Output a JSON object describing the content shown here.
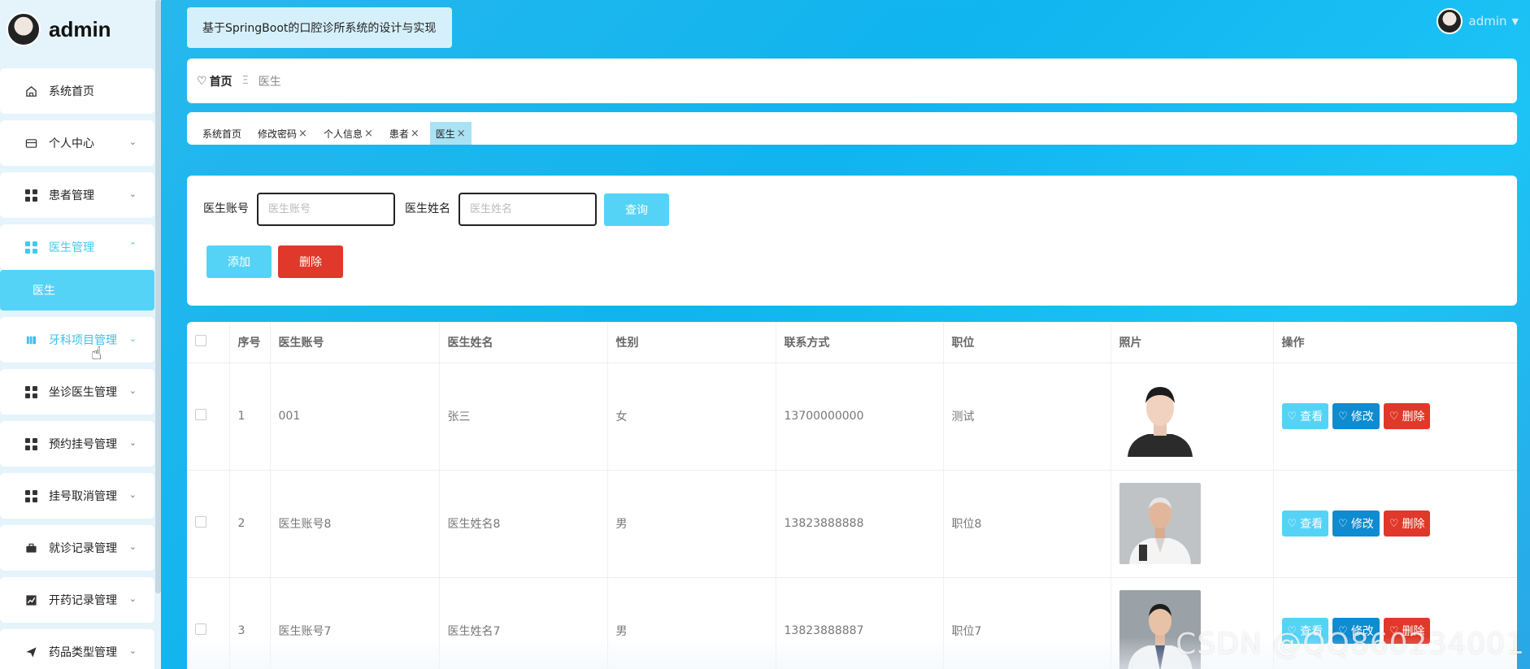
{
  "app": {
    "username": "admin",
    "system_title": "基于SpringBoot的口腔诊所系统的设计与实现"
  },
  "sidebar": {
    "items": [
      {
        "label": "系统首页",
        "icon": "home-icon",
        "has_arrow": false
      },
      {
        "label": "个人中心",
        "icon": "card-icon",
        "has_arrow": true,
        "arrow": "⌄"
      },
      {
        "label": "患者管理",
        "icon": "grid-icon",
        "has_arrow": true,
        "arrow": "⌄"
      },
      {
        "label": "医生管理",
        "icon": "grid-icon",
        "has_arrow": true,
        "arrow": "⌃",
        "active": true
      },
      {
        "label": "牙科项目管理",
        "icon": "book-icon",
        "has_arrow": true,
        "arrow": "⌄"
      },
      {
        "label": "坐诊医生管理",
        "icon": "grid-icon",
        "has_arrow": true,
        "arrow": "⌄"
      },
      {
        "label": "预约挂号管理",
        "icon": "grid-icon",
        "has_arrow": true,
        "arrow": "⌄"
      },
      {
        "label": "挂号取消管理",
        "icon": "grid-icon",
        "has_arrow": true,
        "arrow": "⌄"
      },
      {
        "label": "就诊记录管理",
        "icon": "briefcase-icon",
        "has_arrow": true,
        "arrow": "⌄"
      },
      {
        "label": "开药记录管理",
        "icon": "chart-icon",
        "has_arrow": true,
        "arrow": "⌄"
      },
      {
        "label": "药品类型管理",
        "icon": "send-icon",
        "has_arrow": true,
        "arrow": "⌄"
      }
    ],
    "submenu_active": "医生"
  },
  "breadcrumb": {
    "home": "首页",
    "separator": "Ξ",
    "current": "医生"
  },
  "tags": [
    {
      "label": "系统首页",
      "closable": false
    },
    {
      "label": "修改密码",
      "closable": true
    },
    {
      "label": "个人信息",
      "closable": true
    },
    {
      "label": "患者",
      "closable": true
    },
    {
      "label": "医生",
      "closable": true,
      "active": true
    }
  ],
  "search": {
    "account_label": "医生账号",
    "account_placeholder": "医生账号",
    "name_label": "医生姓名",
    "name_placeholder": "医生姓名",
    "query_button": "查询",
    "add_button": "添加",
    "delete_button": "删除"
  },
  "table": {
    "headers": [
      "序号",
      "医生账号",
      "医生姓名",
      "性别",
      "联系方式",
      "职位",
      "照片",
      "操作"
    ],
    "rows": [
      {
        "index": "1",
        "account": "001",
        "name": "张三",
        "gender": "女",
        "phone": "13700000000",
        "position": "测试"
      },
      {
        "index": "2",
        "account": "医生账号8",
        "name": "医生姓名8",
        "gender": "男",
        "phone": "13823888888",
        "position": "职位8"
      },
      {
        "index": "3",
        "account": "医生账号7",
        "name": "医生姓名7",
        "gender": "男",
        "phone": "13823888887",
        "position": "职位7"
      }
    ],
    "actions": {
      "view": "查看",
      "edit": "修改",
      "delete": "删除"
    }
  },
  "watermark": "CSDN @QQ860234001",
  "colors": {
    "accent": "#55d3f7",
    "edit": "#0e8bd1",
    "danger": "#e0382a",
    "background": "#10b4ef"
  }
}
